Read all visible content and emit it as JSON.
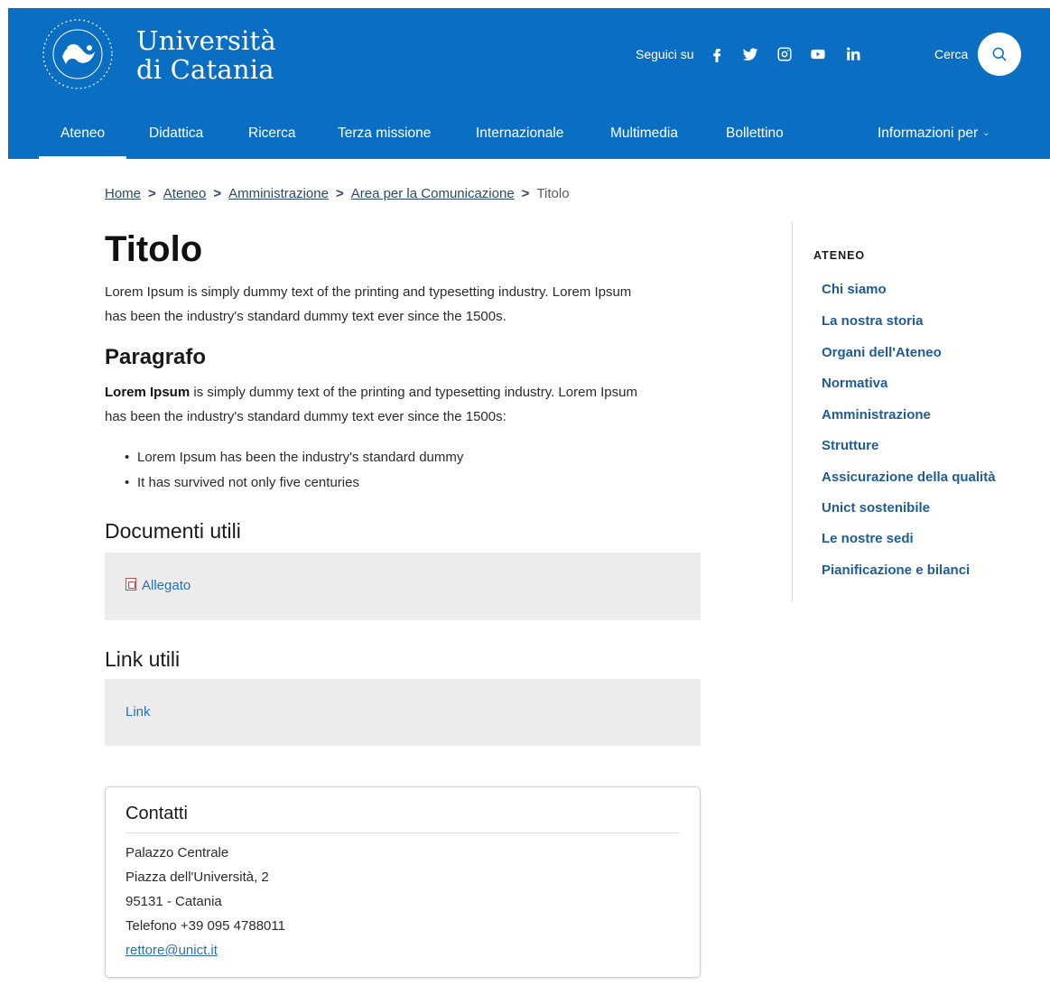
{
  "header": {
    "brand_line1": "Università",
    "brand_line2": "di Catania",
    "follow_label": "Seguici su",
    "social": [
      "facebook-icon",
      "twitter-icon",
      "instagram-icon",
      "youtube-icon",
      "linkedin-icon"
    ],
    "search_label": "Cerca",
    "accent": "#0a6fc2"
  },
  "nav": {
    "items": [
      {
        "label": "Ateneo"
      },
      {
        "label": "Didattica"
      },
      {
        "label": "Ricerca"
      },
      {
        "label": "Terza missione"
      },
      {
        "label": "Internazionale"
      },
      {
        "label": "Multimedia"
      },
      {
        "label": "Bollettino"
      },
      {
        "label": "Informazioni per"
      }
    ],
    "active": "Ateneo"
  },
  "breadcrumb": {
    "items": [
      "Home",
      "Ateneo",
      "Amministrazione",
      "Area per la Comunicazione"
    ],
    "current": "Titolo"
  },
  "main": {
    "title": "Titolo",
    "intro_line1": "Lorem Ipsum is simply dummy text of the printing and typesetting industry. Lorem Ipsum",
    "intro_line2": "has been the industry's standard dummy text ever since the 1500s.",
    "paragraph_heading": "Paragrafo",
    "para_bold": "Lorem Ipsum",
    "para_line1_rest": " is simply dummy text of the printing and typesetting industry. Lorem Ipsum",
    "para_line2": "has been the industry's standard dummy text ever since the 1500s:",
    "bullets": [
      "Lorem Ipsum has been the industry's standard dummy",
      "It has survived not only five centuries"
    ],
    "docs_heading": "Documenti utili",
    "doc_link": "Allegato",
    "links_heading": "Link utili",
    "link": "Link"
  },
  "contact": {
    "title": "Contatti",
    "lines": [
      "Palazzo Centrale",
      "Piazza dell'Università, 2",
      "95131 - Catania",
      "Telefono +39 095 4788011"
    ],
    "email": "rettore@unict.it"
  },
  "sidebar": {
    "heading": "ATENEO",
    "items": [
      "Chi siamo",
      "La nostra storia",
      "Organi dell'Ateneo",
      "Normativa",
      "Amministrazione",
      "Strutture",
      "Assicurazione della qualità",
      "Unict sostenibile",
      "Le nostre sedi",
      "Pianificazione e bilanci"
    ]
  }
}
